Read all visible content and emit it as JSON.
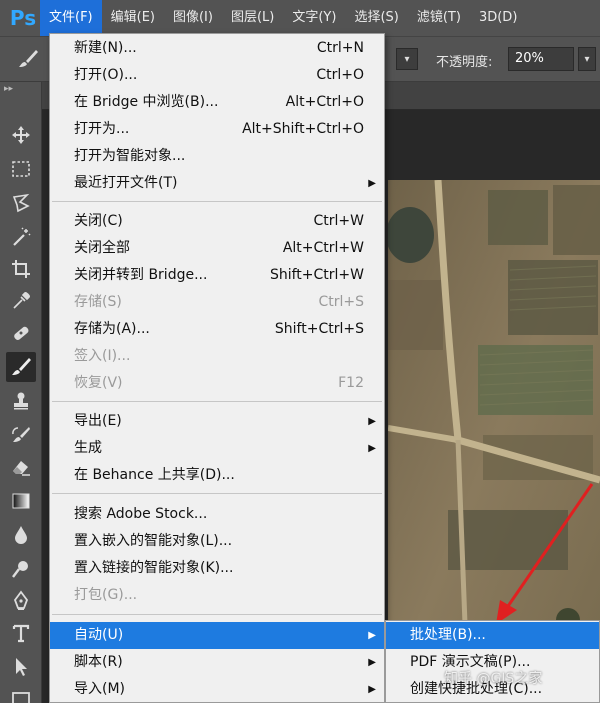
{
  "app": {
    "logo": "Ps"
  },
  "menubar": {
    "items": [
      "文件(F)",
      "编辑(E)",
      "图像(I)",
      "图层(L)",
      "文字(Y)",
      "选择(S)",
      "滤镜(T)",
      "3D(D)"
    ],
    "active_index": 0
  },
  "options": {
    "opacity_label": "不透明度:",
    "opacity_value": "20%"
  },
  "file_menu": {
    "items": [
      {
        "label": "新建(N)...",
        "shortcut": "Ctrl+N",
        "disabled": false
      },
      {
        "label": "打开(O)...",
        "shortcut": "Ctrl+O",
        "disabled": false
      },
      {
        "label": "在 Bridge 中浏览(B)...",
        "shortcut": "Alt+Ctrl+O",
        "disabled": false
      },
      {
        "label": "打开为...",
        "shortcut": "Alt+Shift+Ctrl+O",
        "disabled": false
      },
      {
        "label": "打开为智能对象...",
        "shortcut": "",
        "disabled": false
      },
      {
        "label": "最近打开文件(T)",
        "shortcut": "",
        "disabled": false,
        "submenu": true
      },
      {
        "label": "关闭(C)",
        "shortcut": "Ctrl+W",
        "disabled": false
      },
      {
        "label": "关闭全部",
        "shortcut": "Alt+Ctrl+W",
        "disabled": false
      },
      {
        "label": "关闭并转到 Bridge...",
        "shortcut": "Shift+Ctrl+W",
        "disabled": false
      },
      {
        "label": "存储(S)",
        "shortcut": "Ctrl+S",
        "disabled": true
      },
      {
        "label": "存储为(A)...",
        "shortcut": "Shift+Ctrl+S",
        "disabled": false
      },
      {
        "label": "签入(I)...",
        "shortcut": "",
        "disabled": true
      },
      {
        "label": "恢复(V)",
        "shortcut": "F12",
        "disabled": true
      },
      {
        "label": "导出(E)",
        "shortcut": "",
        "disabled": false,
        "submenu": true
      },
      {
        "label": "生成",
        "shortcut": "",
        "disabled": false,
        "submenu": true
      },
      {
        "label": "在 Behance 上共享(D)...",
        "shortcut": "",
        "disabled": false
      },
      {
        "label": "搜索 Adobe Stock...",
        "shortcut": "",
        "disabled": false
      },
      {
        "label": "置入嵌入的智能对象(L)...",
        "shortcut": "",
        "disabled": false
      },
      {
        "label": "置入链接的智能对象(K)...",
        "shortcut": "",
        "disabled": false
      },
      {
        "label": "打包(G)...",
        "shortcut": "",
        "disabled": true
      },
      {
        "label": "自动(U)",
        "shortcut": "",
        "disabled": false,
        "submenu": true,
        "highlighted": true
      },
      {
        "label": "脚本(R)",
        "shortcut": "",
        "disabled": false,
        "submenu": true
      },
      {
        "label": "导入(M)",
        "shortcut": "",
        "disabled": false,
        "submenu": true
      }
    ]
  },
  "automate_submenu": {
    "items": [
      {
        "label": "批处理(B)...",
        "highlighted": true
      },
      {
        "label": "PDF 演示文稿(P)..."
      },
      {
        "label": "创建快捷批处理(C)..."
      }
    ]
  },
  "watermark": {
    "text": "知乎 @GIS之家"
  },
  "colors": {
    "accent": "#1e7be0",
    "menu_bg": "#f0f0f0",
    "chrome": "#535353",
    "annotation_arrow": "#e02020"
  }
}
